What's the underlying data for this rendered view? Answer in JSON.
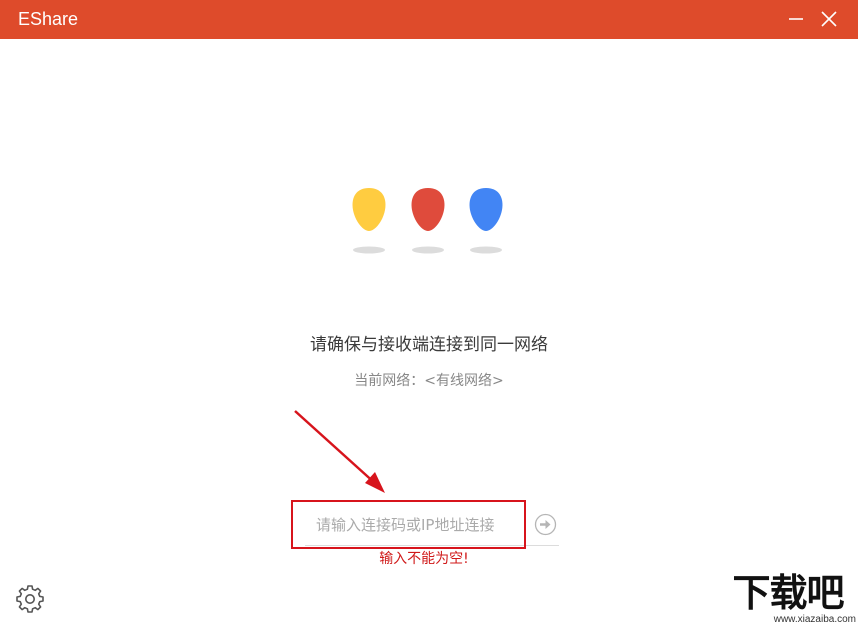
{
  "window": {
    "title": "EShare",
    "titlebar_color": "#de4b2b",
    "minimize_icon": "minimize-icon",
    "close_icon": "close-icon"
  },
  "logo": {
    "dots": [
      {
        "name": "yellow-drop",
        "color": "#ffcc40"
      },
      {
        "name": "red-drop",
        "color": "#df4b3c"
      },
      {
        "name": "blue-drop",
        "color": "#4285f4"
      }
    ]
  },
  "main": {
    "instruction": "请确保与接收端连接到同一网络",
    "network_status": "当前网络：<有线网络>"
  },
  "connect": {
    "value": "",
    "placeholder": "请输入连接码或IP地址连接",
    "button_icon": "arrow-right-circle-icon",
    "error": "输入不能为空!",
    "highlight_color": "#d7141c"
  },
  "settings": {
    "icon": "gear-icon"
  },
  "watermark": {
    "text": "下载吧",
    "url": "www.xiazaiba.com"
  }
}
